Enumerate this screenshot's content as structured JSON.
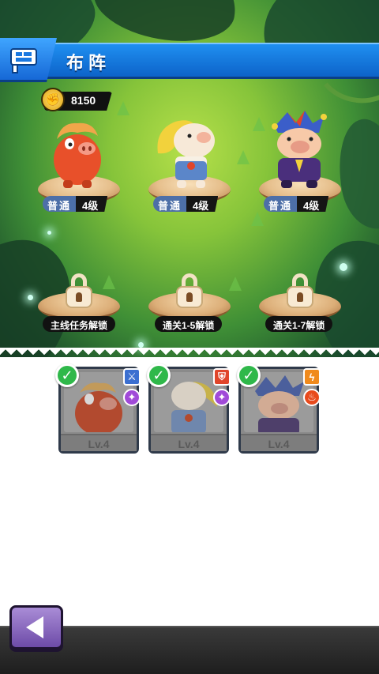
{
  "header": {
    "title": "布阵",
    "icon": "formation-flag-icon"
  },
  "power": {
    "icon": "fist-icon",
    "value": "8150"
  },
  "slots": [
    {
      "character": "red-pig-hero",
      "rarity": "普通",
      "level": "4级"
    },
    {
      "character": "blonde-pig-hero",
      "rarity": "普通",
      "level": "4级"
    },
    {
      "character": "jester-pig-hero",
      "rarity": "普通",
      "level": "4级"
    }
  ],
  "locked_slots": [
    {
      "unlock_text": "主线任务解锁"
    },
    {
      "unlock_text": "通关1-5解锁"
    },
    {
      "unlock_text": "通关1-7解锁"
    }
  ],
  "roster": [
    {
      "character": "red-pig-hero",
      "level": "Lv.4",
      "selected": true,
      "badges": [
        "sword-class-icon",
        "crystal-element-icon"
      ]
    },
    {
      "character": "blonde-pig-hero",
      "level": "Lv.4",
      "selected": true,
      "badges": [
        "shield-class-icon",
        "crystal-element-icon"
      ]
    },
    {
      "character": "jester-pig-hero",
      "level": "Lv.4",
      "selected": true,
      "badges": [
        "lightning-class-icon",
        "fire-element-icon"
      ]
    }
  ],
  "colors": {
    "header_blue": "#1a78e0",
    "check_green": "#2fb84a",
    "rarity_blue": "#4d6fa8",
    "back_button_purple": "#8b6bc4"
  },
  "footer": {
    "back_icon": "back-arrow-icon"
  }
}
